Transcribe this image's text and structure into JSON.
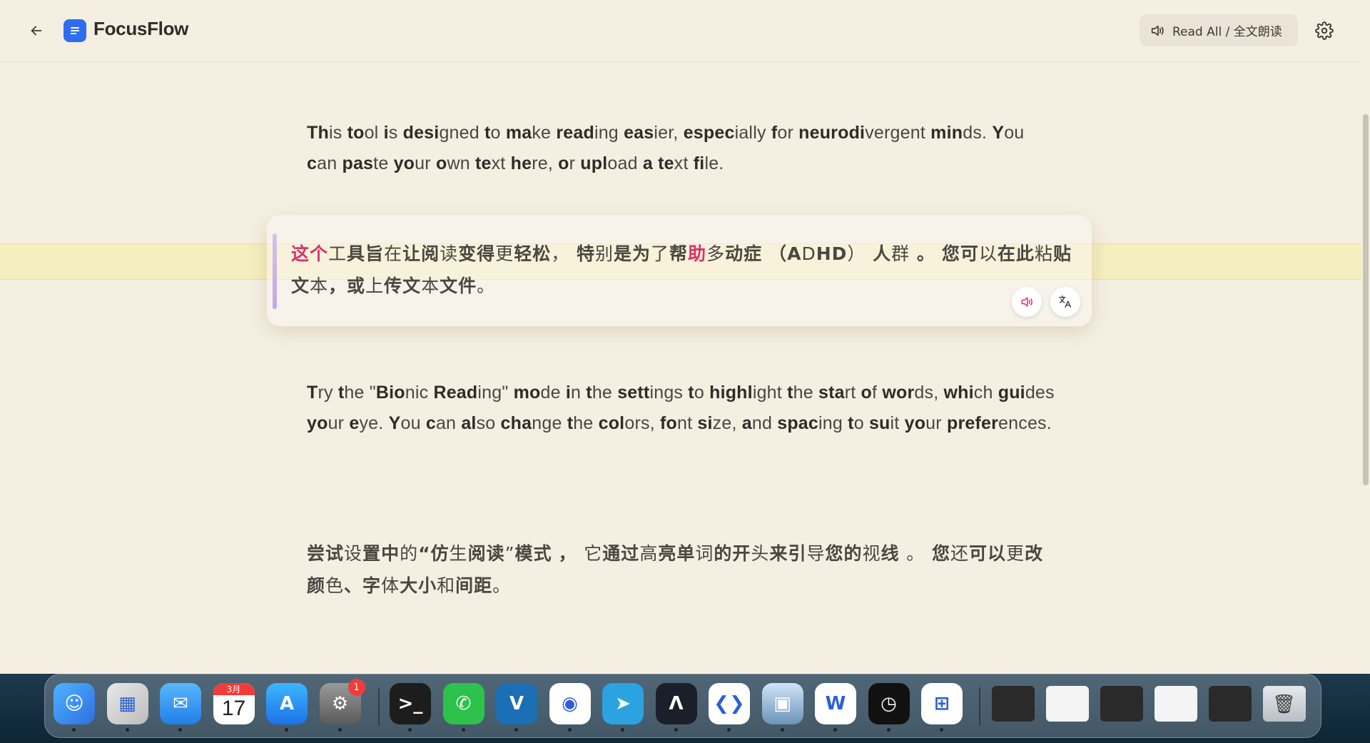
{
  "app": {
    "title": "FocusFlow",
    "read_all_label": "Read All / 全文朗读"
  },
  "paragraphs": {
    "p1_line1": [
      [
        "Th",
        "is",
        1
      ],
      [
        " ",
        ""
      ],
      [
        "to",
        "ol",
        1
      ],
      [
        " ",
        ""
      ],
      [
        "i",
        "s",
        1
      ],
      [
        " ",
        ""
      ],
      [
        "desi",
        "gned",
        1
      ],
      [
        " ",
        ""
      ],
      [
        "t",
        "o",
        1
      ],
      [
        " ",
        ""
      ],
      [
        "ma",
        "ke",
        1
      ],
      [
        " ",
        ""
      ],
      [
        "read",
        "ing",
        1
      ],
      [
        " ",
        ""
      ],
      [
        "eas",
        "ier,",
        1
      ],
      [
        " ",
        ""
      ],
      [
        "espec",
        "ially",
        1
      ],
      [
        " ",
        ""
      ],
      [
        "f",
        "or",
        1
      ],
      [
        " ",
        ""
      ],
      [
        "neurodi",
        "vergent",
        1
      ]
    ],
    "p1_text": "This tool is designed to make reading easier, especially for neurodivergent minds. You can paste your own text here, or upload a text file.",
    "p2_text": "这个工具旨在让阅读变得更轻松， 特别是为了帮助多动症 （ADHD） 人群 。 您可以在此粘贴文本，或上传文本文件。",
    "p3_text": "Try the \"Bionic Reading\" mode in the settings to highlight the start of words, which guides your eye. You can also change the colors, font size, and spacing to suit your preferences.",
    "p4_text": "尝试设置中的“仿生阅读”模式 ， 它通过高亮单词的开头来引导您的视线 。 您还可以更改颜色、字体大小和间距。"
  },
  "dock": {
    "apps": [
      {
        "name": "finder",
        "label": "Finder"
      },
      {
        "name": "launchpad",
        "label": "Launchpad"
      },
      {
        "name": "mail",
        "label": "Mail"
      },
      {
        "name": "calendar",
        "label": "Calendar",
        "month": "3月",
        "day": "17"
      },
      {
        "name": "app-store",
        "label": "App Store"
      },
      {
        "name": "system-settings",
        "label": "System Settings",
        "badge": "1"
      },
      {
        "name": "terminal",
        "label": "Terminal"
      },
      {
        "name": "wechat",
        "label": "WeChat"
      },
      {
        "name": "vim",
        "label": "Vim"
      },
      {
        "name": "chrome",
        "label": "Chrome"
      },
      {
        "name": "telegram",
        "label": "Telegram"
      },
      {
        "name": "arc",
        "label": "Arc"
      },
      {
        "name": "vscode",
        "label": "VS Code"
      },
      {
        "name": "preview",
        "label": "Preview"
      },
      {
        "name": "word",
        "label": "Word"
      },
      {
        "name": "clock",
        "label": "Clock"
      },
      {
        "name": "windows",
        "label": "Windows App"
      }
    ]
  },
  "colors": {
    "background": "#f5efe2",
    "highlight_band": "#f5eebe",
    "accent_red": "#d8336a",
    "logo_blue": "#2f6cf0"
  }
}
